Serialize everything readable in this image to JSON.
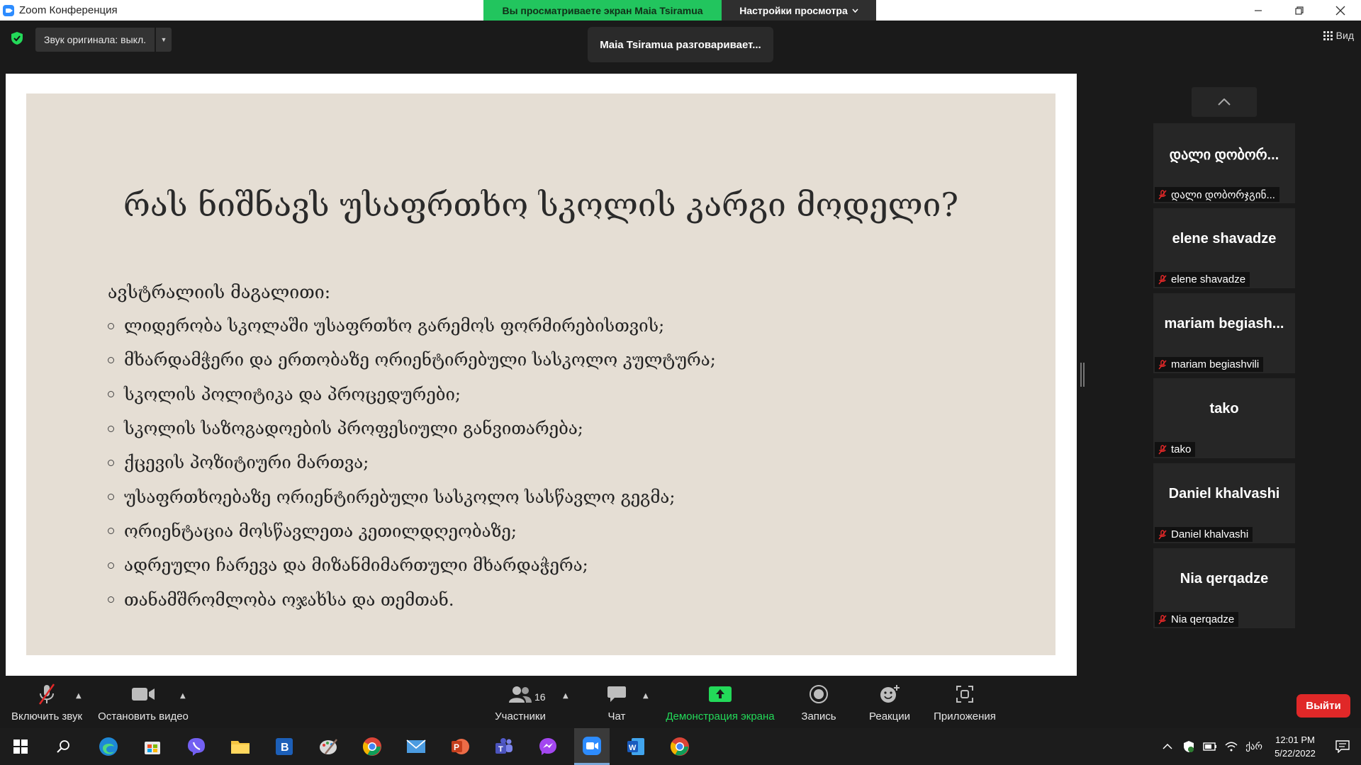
{
  "window": {
    "title": "Zoom Конференция"
  },
  "share_banner": {
    "status": "Вы просматриваете экран Maia Tsiramua",
    "settings": "Настройки просмотра"
  },
  "top": {
    "original_sound": "Звук оригинала: выкл.",
    "speaking": "Maia Tsiramua разговаривает...",
    "view": "Вид"
  },
  "slide": {
    "title": "რას ნიშნავს უსაფრთხო სკოლის კარგი მოდელი?",
    "subtitle": "ავსტრალიის მაგალითი:",
    "bullets": [
      "ლიდერობა სკოლაში უსაფრთხო გარემოს ფორმირებისთვის;",
      "მხარდამჭერი და ერთობაზე ორიენტირებული სასკოლო კულტურა;",
      " სკოლის პოლიტიკა და პროცედურები;",
      " სკოლის საზოგადოების პროფესიული განვითარება;",
      "ქცევის პოზიტიური მართვა;",
      "უსაფრთხოებაზე ორიენტირებული სასკოლო სასწავლო გეგმა;",
      " ორიენტაცია მოსწავლეთა კეთილდღეობაზე;",
      "ადრეული ჩარევა და მიზანმიმართული მხარდაჭერა;",
      " თანამშრომლობა ოჯახსა და თემთან."
    ]
  },
  "participants": [
    {
      "display": "დალი დობორ...",
      "tag": "დალი დობორჯგინ..."
    },
    {
      "display": "elene shavadze",
      "tag": "elene shavadze"
    },
    {
      "display": "mariam  begiash...",
      "tag": "mariam begiashvili"
    },
    {
      "display": "tako",
      "tag": "tako"
    },
    {
      "display": "Daniel khalvashi",
      "tag": "Daniel khalvashi"
    },
    {
      "display": "Nia qerqadze",
      "tag": "Nia qerqadze"
    }
  ],
  "toolbar": {
    "unmute": "Включить звук",
    "stop_video": "Остановить видео",
    "participants": "Участники",
    "participants_count": "16",
    "chat": "Чат",
    "share": "Демонстрация экрана",
    "record": "Запись",
    "reactions": "Реакции",
    "apps": "Приложения",
    "leave": "Выйти"
  },
  "taskbar": {
    "time": "12:01 PM",
    "date": "5/22/2022",
    "lang": "ქარ"
  },
  "colors": {
    "accent_green": "#23d959",
    "leave_red": "#e02828",
    "slide_bg": "#e5ded4"
  }
}
